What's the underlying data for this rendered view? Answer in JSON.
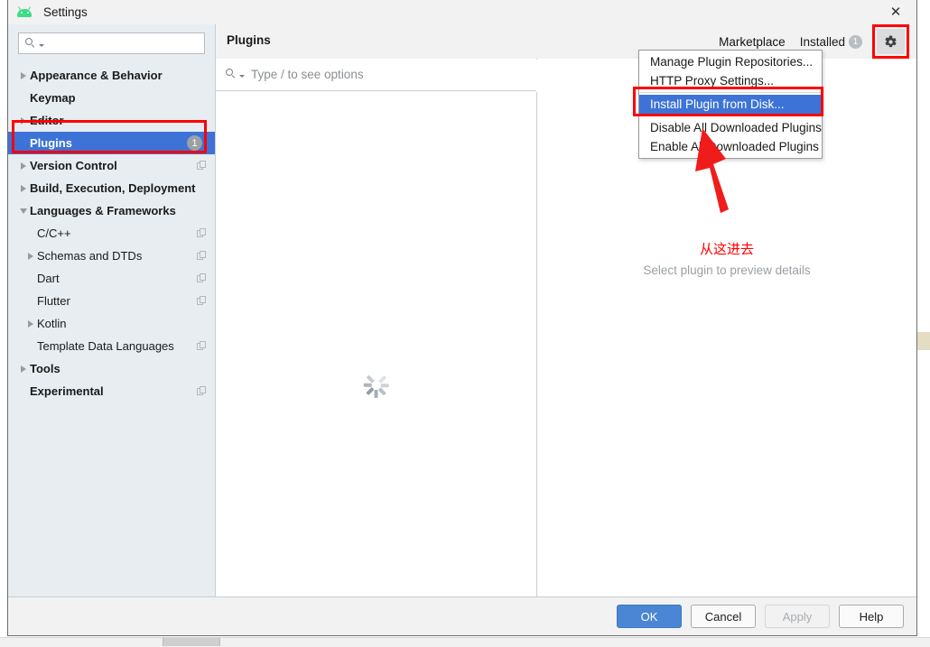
{
  "window": {
    "title": "Settings",
    "app_icon": "android-icon",
    "close_icon": "close-icon"
  },
  "sidebar": {
    "search": {
      "placeholder": "",
      "value": "",
      "icon": "search-icon"
    },
    "items": [
      {
        "label": "Appearance & Behavior",
        "arrow": "right",
        "bold": true,
        "level": 1,
        "selected": false,
        "badge": null,
        "copy": false
      },
      {
        "label": "Keymap",
        "arrow": "none",
        "bold": true,
        "level": 1,
        "selected": false,
        "badge": null,
        "copy": false
      },
      {
        "label": "Editor",
        "arrow": "right",
        "bold": true,
        "level": 1,
        "selected": false,
        "badge": null,
        "copy": false
      },
      {
        "label": "Plugins",
        "arrow": "none",
        "bold": true,
        "level": 1,
        "selected": true,
        "badge": "1",
        "copy": false
      },
      {
        "label": "Version Control",
        "arrow": "right",
        "bold": true,
        "level": 1,
        "selected": false,
        "badge": null,
        "copy": true
      },
      {
        "label": "Build, Execution, Deployment",
        "arrow": "right",
        "bold": true,
        "level": 1,
        "selected": false,
        "badge": null,
        "copy": false
      },
      {
        "label": "Languages & Frameworks",
        "arrow": "down",
        "bold": true,
        "level": 1,
        "selected": false,
        "badge": null,
        "copy": false
      },
      {
        "label": "C/C++",
        "arrow": "none",
        "bold": false,
        "level": 2,
        "selected": false,
        "badge": null,
        "copy": true
      },
      {
        "label": "Schemas and DTDs",
        "arrow": "right",
        "bold": false,
        "level": 2,
        "selected": false,
        "badge": null,
        "copy": true
      },
      {
        "label": "Dart",
        "arrow": "none",
        "bold": false,
        "level": 2,
        "selected": false,
        "badge": null,
        "copy": true
      },
      {
        "label": "Flutter",
        "arrow": "none",
        "bold": false,
        "level": 2,
        "selected": false,
        "badge": null,
        "copy": true
      },
      {
        "label": "Kotlin",
        "arrow": "right",
        "bold": false,
        "level": 2,
        "selected": false,
        "badge": null,
        "copy": false
      },
      {
        "label": "Template Data Languages",
        "arrow": "none",
        "bold": false,
        "level": 2,
        "selected": false,
        "badge": null,
        "copy": true
      },
      {
        "label": "Tools",
        "arrow": "right",
        "bold": true,
        "level": 1,
        "selected": false,
        "badge": null,
        "copy": false
      },
      {
        "label": "Experimental",
        "arrow": "none",
        "bold": true,
        "level": 1,
        "selected": false,
        "badge": null,
        "copy": true
      }
    ]
  },
  "content": {
    "title": "Plugins",
    "tabs": [
      {
        "label": "Marketplace",
        "active": true,
        "badge": null
      },
      {
        "label": "Installed",
        "active": false,
        "badge": "1"
      }
    ],
    "gear_icon": "gear-icon",
    "plugin_search": {
      "placeholder": "Type / to see options",
      "value": "",
      "icon": "search-icon"
    },
    "preview_placeholder": "Select plugin to preview details",
    "loading_icon": "loading-spinner-icon"
  },
  "menu": {
    "items": [
      {
        "label": "Manage Plugin Repositories...",
        "highlight": false,
        "separator_before": false
      },
      {
        "label": "HTTP Proxy Settings...",
        "highlight": false,
        "separator_before": false
      },
      {
        "label": "Install Plugin from Disk...",
        "highlight": true,
        "separator_before": true
      },
      {
        "label": "Disable All Downloaded Plugins",
        "highlight": false,
        "separator_before": true
      },
      {
        "label": "Enable All Downloaded Plugins",
        "highlight": false,
        "separator_before": false
      }
    ]
  },
  "annotations": {
    "chinese_note": "从这进去",
    "highlight_color": "#ff0000"
  },
  "footer": {
    "buttons": [
      {
        "label": "OK",
        "style": "primary"
      },
      {
        "label": "Cancel",
        "style": "normal"
      },
      {
        "label": "Apply",
        "style": "disabled"
      },
      {
        "label": "Help",
        "style": "normal"
      }
    ]
  }
}
